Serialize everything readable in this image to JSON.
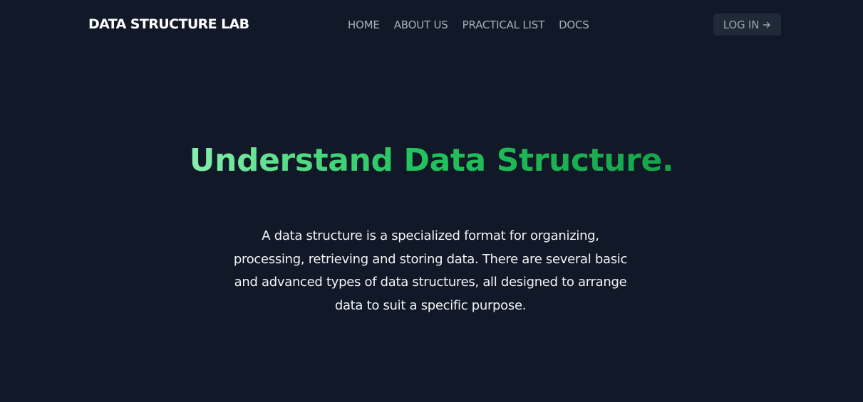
{
  "navbar": {
    "brand": "DATA STRUCTURE LAB",
    "links": [
      {
        "label": "HOME"
      },
      {
        "label": "ABOUT US"
      },
      {
        "label": "PRACTICAL LIST"
      },
      {
        "label": "DOCS"
      }
    ],
    "login_label": "LOG IN",
    "login_icon": "arrow-right-icon"
  },
  "hero": {
    "title": "Understand Data Structure.",
    "description": "A data structure is a specialized format for organizing, processing, retrieving and storing data. There are several basic and advanced types of data structures, all designed to arrange data to suit a specific purpose."
  },
  "colors": {
    "background": "#111827",
    "nav_link": "#a6aebb",
    "login_bg": "#1f2937",
    "title_gradient_start": "#86efac",
    "title_gradient_end": "#16a34a",
    "body_text": "#f3f4f6"
  }
}
